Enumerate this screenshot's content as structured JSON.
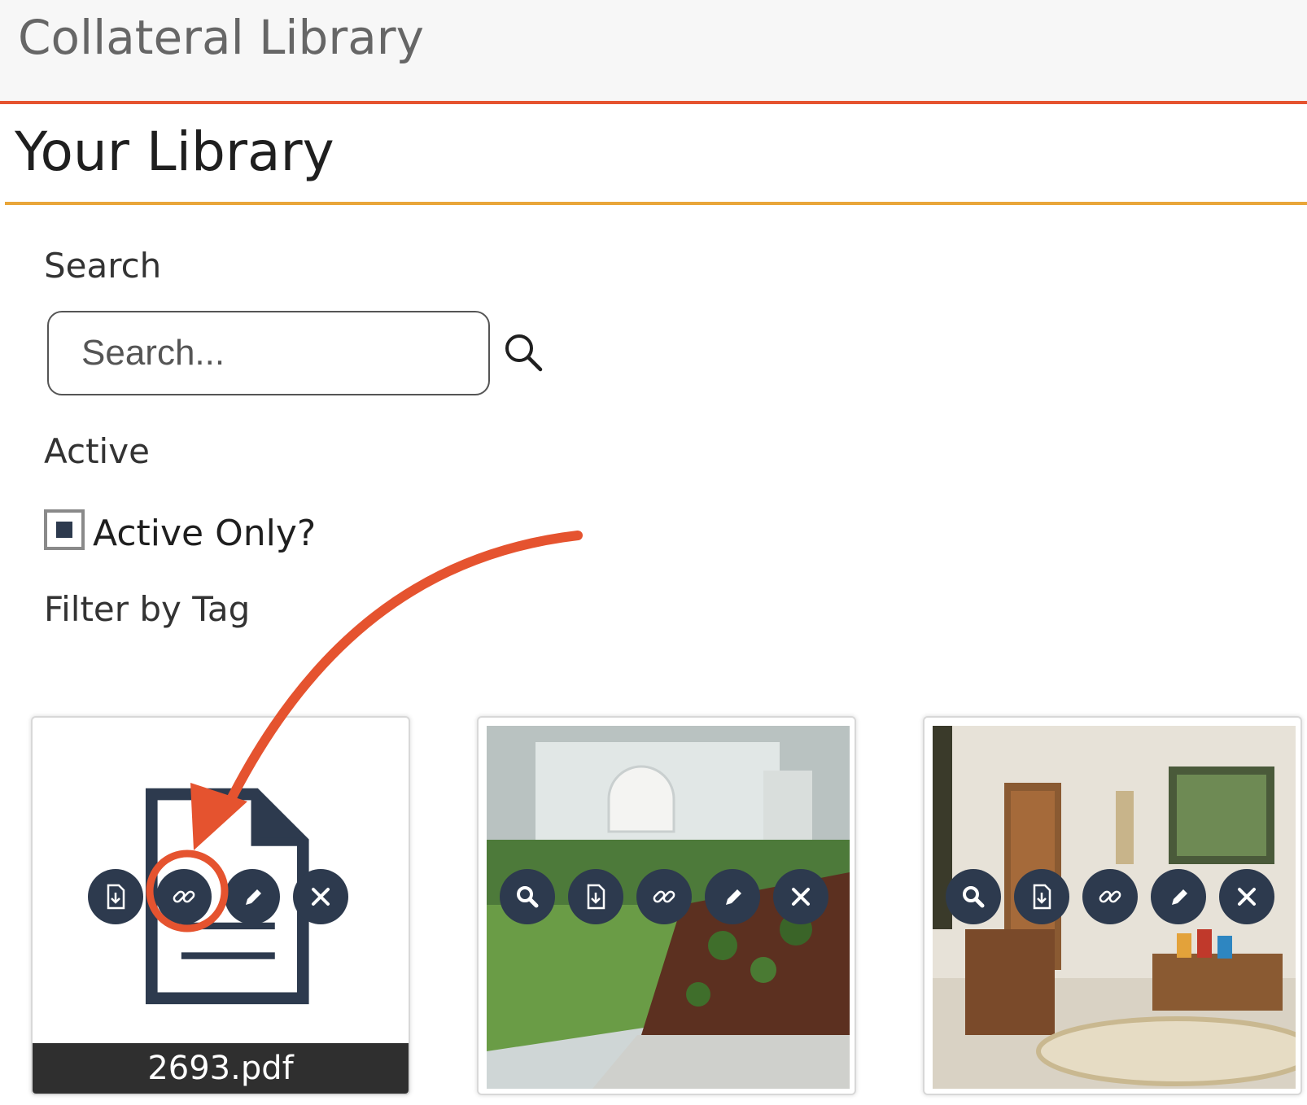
{
  "app": {
    "title": "Collateral Library"
  },
  "page": {
    "heading": "Your Library"
  },
  "filters": {
    "search_label": "Search",
    "search_placeholder": "Search...",
    "active_label": "Active",
    "active_only_label": "Active Only?",
    "active_only_checked": true,
    "tag_label": "Filter by Tag"
  },
  "items": [
    {
      "filename": "2693.pdf",
      "type": "pdf",
      "actions": [
        "download-icon",
        "link-icon",
        "edit-icon",
        "delete-icon"
      ]
    },
    {
      "filename": "",
      "type": "image",
      "subject": "house front yard",
      "actions": [
        "zoom-icon",
        "download-icon",
        "link-icon",
        "edit-icon",
        "delete-icon"
      ]
    },
    {
      "filename": "",
      "type": "image",
      "subject": "interior room",
      "actions": [
        "zoom-icon",
        "download-icon",
        "link-icon",
        "edit-icon",
        "delete-icon"
      ]
    }
  ],
  "colors": {
    "accent_red": "#e5532f",
    "accent_orange": "#e9a63a",
    "action_bg": "#2d3a4e"
  }
}
